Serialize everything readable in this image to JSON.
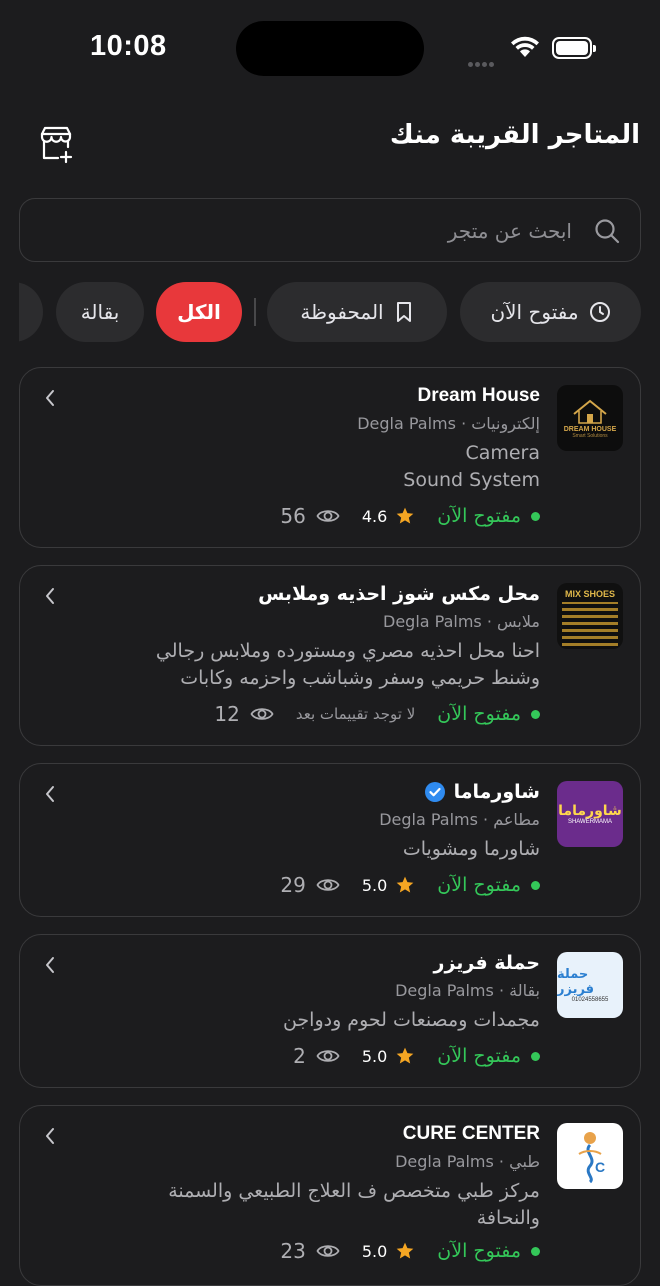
{
  "status_bar": {
    "time": "10:08"
  },
  "header": {
    "title": "المتاجر القريبة منك"
  },
  "search": {
    "placeholder": "ابحث عن متجر"
  },
  "filters": [
    {
      "label": "مفتوح الآن",
      "icon": "clock-icon"
    },
    {
      "label": "المحفوظة",
      "icon": "bookmark-icon"
    },
    {
      "label": "الكل",
      "active": true
    },
    {
      "label": "بقالة"
    }
  ],
  "colors": {
    "accent": "#e8383b",
    "open": "#34c759",
    "star": "#f5a623",
    "background": "#1c1c1e"
  },
  "stores": [
    {
      "name": "Dream House",
      "meta": "إلكترونيات · Degla Palms",
      "desc_lines": [
        "Camera",
        "Sound System"
      ],
      "status": "مفتوح الآن",
      "rating": "4.6",
      "views": "56",
      "thumb_text": "DREAM HOUSE",
      "thumb_sub": "Smart Solutions"
    },
    {
      "name": "محل مكس شوز احذيه وملابس",
      "meta": "ملابس · Degla Palms",
      "desc_lines": [
        "احنا محل احذيه مصري ومستورده وملابس رجالي",
        "وشنط حريمي وسفر وشباشب واحزمه وكابات"
      ],
      "status": "مفتوح الآن",
      "no_rating": "لا توجد تقييمات بعد",
      "views": "12",
      "thumb_text": "MIX SHOES"
    },
    {
      "name": "شاورماما",
      "meta": "مطاعم · Degla Palms",
      "desc_lines": [
        "شاورما ومشويات"
      ],
      "status": "مفتوح الآن",
      "rating": "5.0",
      "views": "29",
      "thumb_text": "شاورماما",
      "thumb_sub": "SHAWERMAMA"
    },
    {
      "name": "حملة فريزر",
      "meta": "بقالة · Degla Palms",
      "desc_lines": [
        "مجمدات ومصنعات لحوم ودواجن"
      ],
      "status": "مفتوح الآن",
      "rating": "5.0",
      "views": "2",
      "thumb_text": "حملة فريزر",
      "thumb_sub": "01024558655"
    },
    {
      "name": "CURE CENTER",
      "meta": "طبي · Degla Palms",
      "desc_lines": [
        "مركز طبي متخصص ف العلاج الطبيعي والسمنة",
        "والنحافة"
      ],
      "status": "مفتوح الآن",
      "rating": "5.0",
      "views": "23"
    }
  ]
}
